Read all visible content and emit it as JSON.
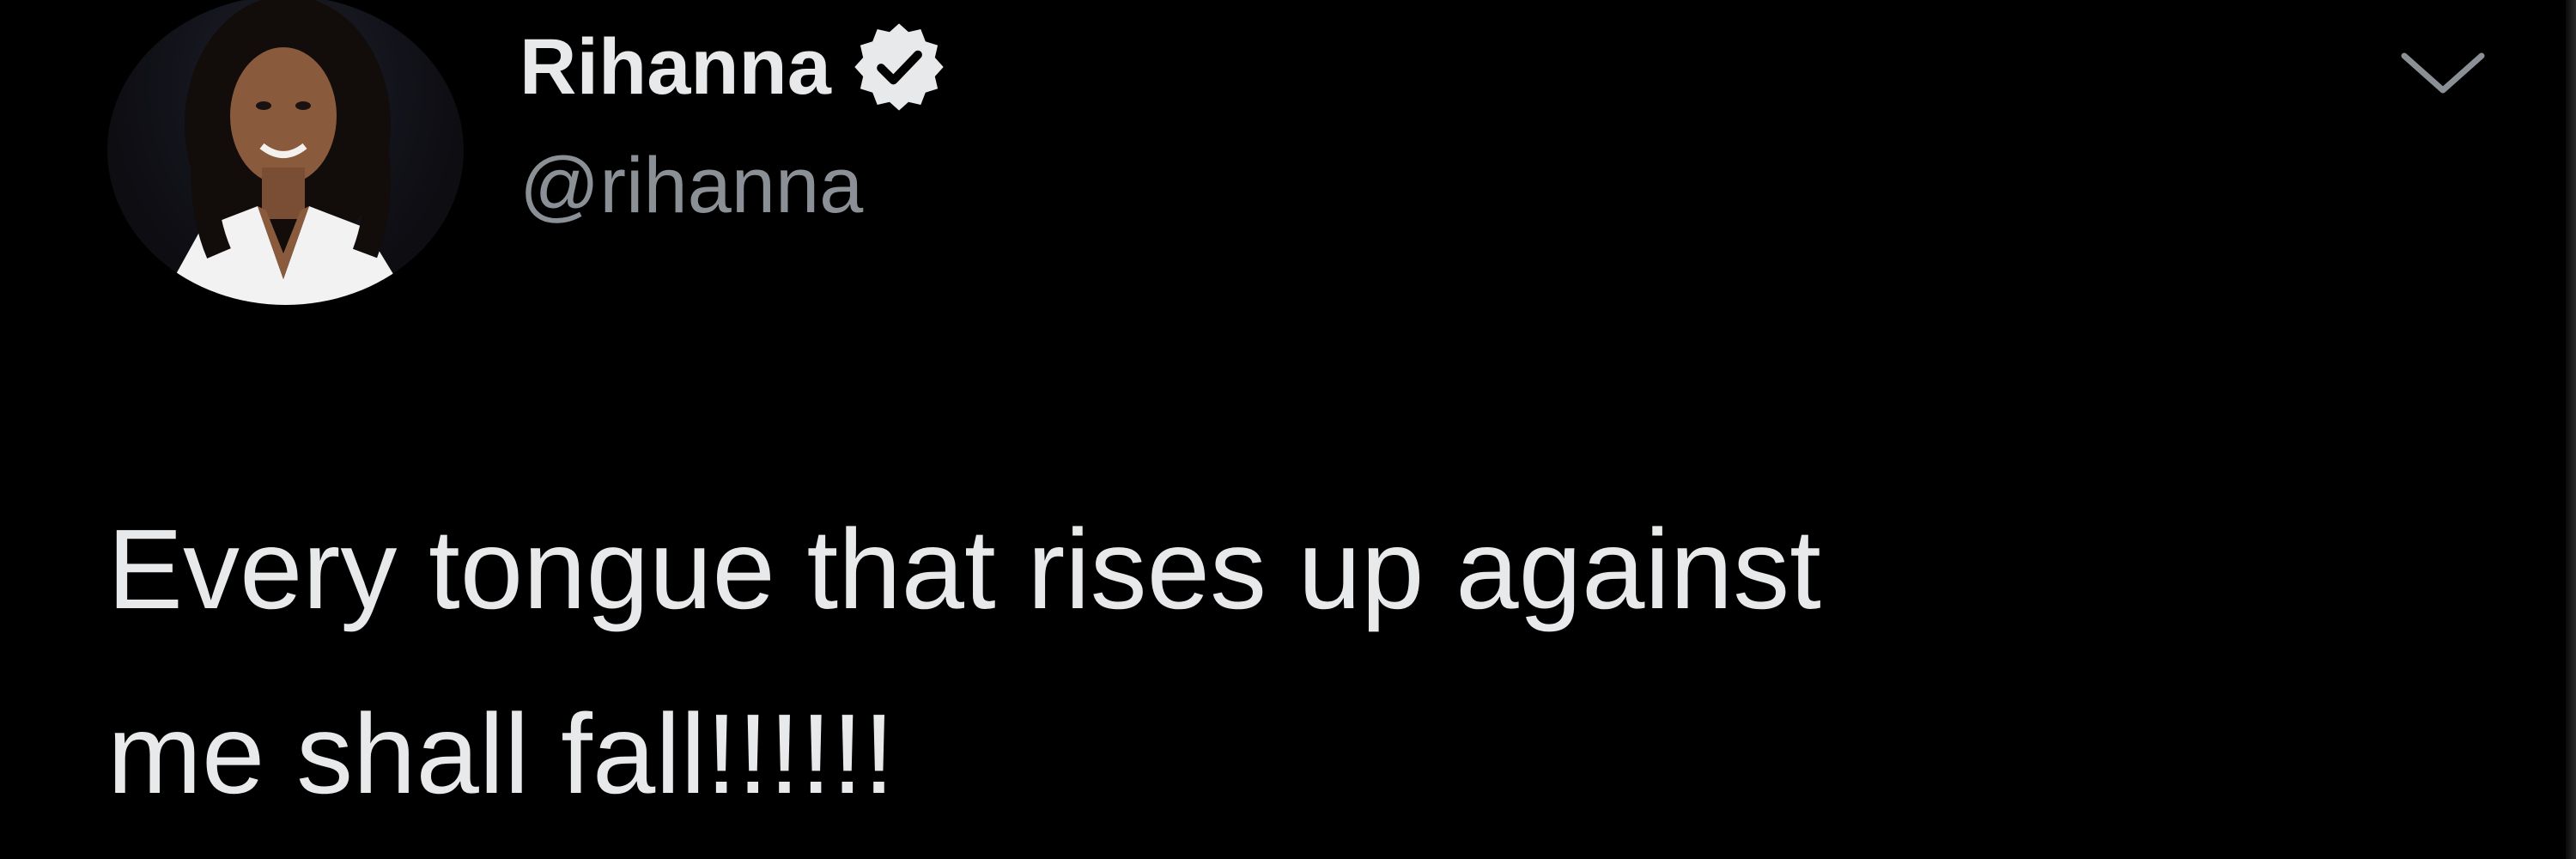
{
  "tweet": {
    "author": {
      "display_name": "Rihanna",
      "handle": "@rihanna",
      "verified": true,
      "avatar": "avatar-photo"
    },
    "text": "Every tongue that rises up against\nme shall fall!!!!!!",
    "menu_icon": "chevron-down-icon"
  },
  "colors": {
    "background": "#000000",
    "primary_text": "#e7e9ea",
    "secondary_text": "#8b9096",
    "verified_badge": "#e7e9ea"
  }
}
